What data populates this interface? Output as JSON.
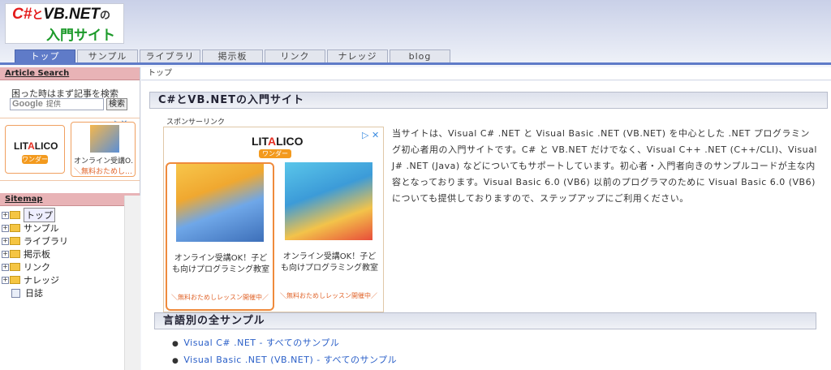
{
  "logo": {
    "line1_a": "C#",
    "line1_b": "と",
    "line1_c": "VB.NET",
    "line1_d": "の",
    "line2": "入門サイト"
  },
  "nav": {
    "tabs": [
      "トップ",
      "サンプル",
      "ライブラリ",
      "掲示板",
      "リンク",
      "ナレッジ",
      "blog"
    ],
    "active": 0
  },
  "sidebar": {
    "search_title": "Article Search",
    "search_hint": "困った時はまず記事を検索",
    "search_google": "Google",
    "search_google_sub": "提供",
    "search_button": "検索",
    "ad": {
      "brand_a": "LIT",
      "brand_b": "A",
      "brand_c": "LICO",
      "sub": "ワンダー",
      "title": "オンライン受講O…",
      "cta": "＼無料おためし…"
    },
    "sitemap_title": "Sitemap",
    "tree": [
      "トップ",
      "サンプル",
      "ライブラリ",
      "掲示板",
      "リンク",
      "ナレッジ",
      "日誌"
    ]
  },
  "breadcrumb": "トップ",
  "main": {
    "heading": "C#とVB.NETの入門サイト",
    "sponsor_label": "スポンサーリンク",
    "ad": {
      "brand_a": "LIT",
      "brand_b": "A",
      "brand_c": "LICO",
      "sub": "ワンダー",
      "cards": [
        {
          "title": "オンライン受講OK！子ども向けプログラミング教室",
          "cta": "＼無料おためしレッスン開催中／"
        },
        {
          "title": "オンライン受講OK！子ども向けプログラミング教室",
          "cta": "＼無料おためしレッスン開催中／"
        }
      ]
    },
    "intro": "当サイトは、Visual C# .NET と Visual Basic .NET (VB.NET) を中心とした .NET プログラミング初心者用の入門サイトです。C# と VB.NET だけでなく、Visual C++ .NET (C++/CLI)、Visual J# .NET (Java) などについてもサポートしています。初心者・入門者向きのサンプルコードが主な内容となっております。Visual Basic 6.0 (VB6) 以前のプログラマのために Visual Basic 6.0 (VB6) についても提供しておりますので、ステップアップにご利用ください。",
    "section2": "言語別の全サンプル",
    "links": [
      "Visual C# .NET - すべてのサンプル",
      "Visual Basic .NET (VB.NET) - すべてのサンプル"
    ]
  },
  "colors": {
    "accent": "#5f7bc8",
    "sidebar_head": "#e8b3b6",
    "link": "#2a5fc8",
    "ad_orange": "#ef8a3c"
  }
}
